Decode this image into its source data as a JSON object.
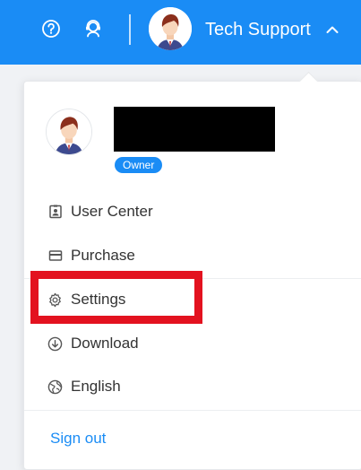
{
  "header": {
    "help_icon": "question-circle-icon",
    "support_icon": "headset-icon",
    "user_name": "Tech Support",
    "expand_icon": "chevron-up-icon"
  },
  "profile": {
    "role_badge": "Owner"
  },
  "menu": {
    "items": [
      {
        "label": "User Center",
        "icon": "id-badge-icon"
      },
      {
        "label": "Purchase",
        "icon": "card-icon"
      },
      {
        "label": "Settings",
        "icon": "gear-icon"
      },
      {
        "label": "Download",
        "icon": "download-icon"
      },
      {
        "label": "English",
        "icon": "globe-icon"
      }
    ],
    "sign_out": "Sign out"
  },
  "colors": {
    "brand_blue": "#1a8cf5",
    "highlight_red": "#e3121f",
    "text": "#333333"
  }
}
